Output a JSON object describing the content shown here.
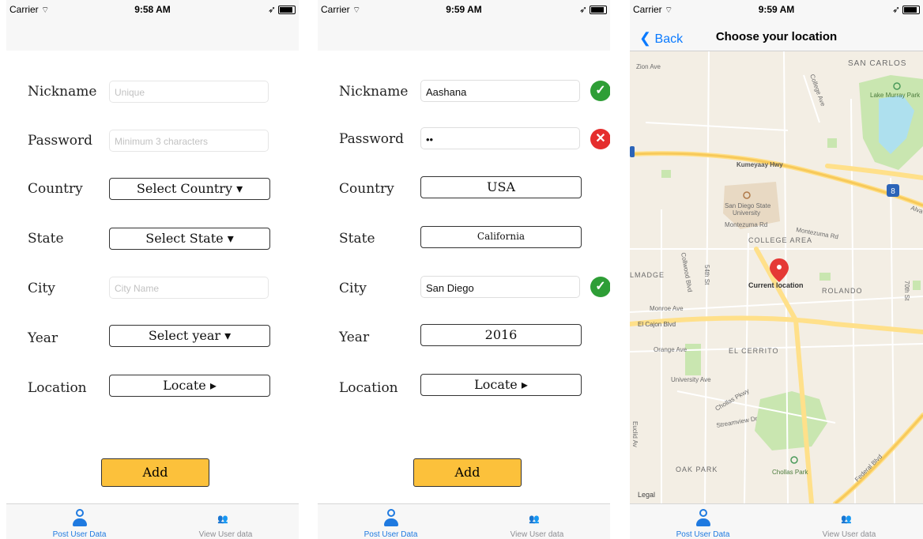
{
  "statusbar": {
    "s1": {
      "carrier": "Carrier",
      "time": "9:58 AM"
    },
    "s2": {
      "carrier": "Carrier",
      "time": "9:59 AM"
    },
    "s3": {
      "carrier": "Carrier",
      "time": "9:59 AM"
    }
  },
  "form_empty": {
    "nickname_label": "Nickname",
    "nickname_placeholder": "Unique",
    "password_label": "Password",
    "password_placeholder": "Minimum 3 characters",
    "country_label": "Country",
    "country_button": "Select Country ▾",
    "state_label": "State",
    "state_button": "Select State ▾",
    "city_label": "City",
    "city_placeholder": "City Name",
    "year_label": "Year",
    "year_button": "Select year ▾",
    "location_label": "Location",
    "location_button": "Locate ▸",
    "add_label": "Add"
  },
  "form_filled": {
    "nickname_label": "Nickname",
    "nickname_value": "Aashana",
    "password_label": "Password",
    "password_value": "••",
    "country_label": "Country",
    "country_button": "USA",
    "state_label": "State",
    "state_button": "California",
    "city_label": "City",
    "city_value": "San Diego",
    "year_label": "Year",
    "year_button": "2016",
    "location_label": "Location",
    "location_button": "Locate ▸",
    "add_label": "Add",
    "nickname_status": "valid",
    "password_status": "invalid",
    "city_status": "valid"
  },
  "tabs": {
    "post": "Post User Data",
    "view": "View User data"
  },
  "location_screen": {
    "back": "Back",
    "title": "Choose your location",
    "map_labels": {
      "zion": "Zion Ave",
      "san_carlos": "SAN CARLOS",
      "lake": "Lake Murray Park",
      "college_ave": "College Ave",
      "kumeyaay": "Kumeyaay Hwy",
      "sdsu": "San Diego State",
      "sdsu2": "University",
      "montezuma": "Montezuma Rd",
      "montezuma2": "Montezuma Rd",
      "college_area": "COLLEGE AREA",
      "talmadge": "LMADGE",
      "current": "Current location",
      "rolando": "ROLANDO",
      "monroe": "Monroe Ave",
      "el_cajon": "El Cajon Blvd",
      "orange": "Orange Ave",
      "el_cerrito": "EL CERRITO",
      "university": "University Ave",
      "chollas_pkwy": "Chollas Pkwy",
      "streamview": "Streamview Dr",
      "oak_park": "OAK PARK",
      "chollas_park": "Chollas Park",
      "federal": "Federal Blvd",
      "legal": "Legal",
      "collwood": "Collwood Blvd",
      "st54": "54th St",
      "st70": "70th St",
      "alva": "Alva",
      "euclid": "Euclid Av",
      "i8": "8"
    }
  },
  "colors": {
    "accent": "#1f7ae0",
    "add_button": "#fcc13b",
    "valid": "#2e9e36",
    "invalid": "#e52e2e",
    "pin": "#e53935"
  }
}
